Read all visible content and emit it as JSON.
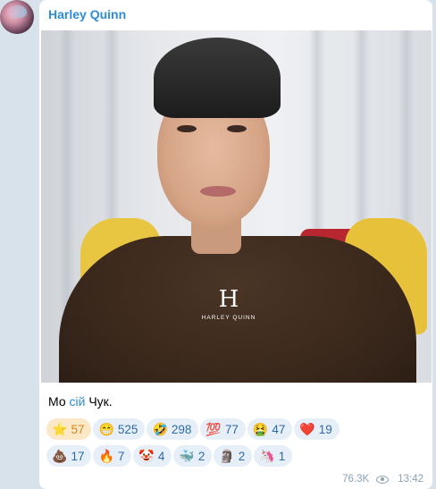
{
  "author": "Harley Quinn",
  "avatar_icon": "avatar-icon",
  "watermark": {
    "logo": "H",
    "text": "HARLEY QUINN"
  },
  "caption": {
    "part1": "Мо ",
    "link": "сій",
    "part2": " Чук."
  },
  "reactions": [
    {
      "emoji": "⭐",
      "count": "57",
      "active": true,
      "icon": "star-icon"
    },
    {
      "emoji": "😁",
      "count": "525",
      "active": false,
      "icon": "grin-icon"
    },
    {
      "emoji": "🤣",
      "count": "298",
      "active": false,
      "icon": "rofl-icon"
    },
    {
      "emoji": "💯",
      "count": "77",
      "active": false,
      "icon": "hundred-icon"
    },
    {
      "emoji": "🤮",
      "count": "47",
      "active": false,
      "icon": "vomit-icon"
    },
    {
      "emoji": "❤️",
      "count": "19",
      "active": false,
      "icon": "heart-icon"
    },
    {
      "emoji": "💩",
      "count": "17",
      "active": false,
      "icon": "poo-icon"
    },
    {
      "emoji": "🔥",
      "count": "7",
      "active": false,
      "icon": "fire-icon"
    },
    {
      "emoji": "🤡",
      "count": "4",
      "active": false,
      "icon": "clown-icon"
    },
    {
      "emoji": "🐳",
      "count": "2",
      "active": false,
      "icon": "whale-icon"
    },
    {
      "emoji": "🗿",
      "count": "2",
      "active": false,
      "icon": "moai-icon"
    },
    {
      "emoji": "🦄",
      "count": "1",
      "active": false,
      "icon": "unicorn-icon"
    }
  ],
  "views": "76.3K",
  "time": "13:42",
  "colors": {
    "accent": "#2e8bd8",
    "chip_bg": "#e6eff7",
    "chip_active_bg": "#fbe8c6"
  }
}
